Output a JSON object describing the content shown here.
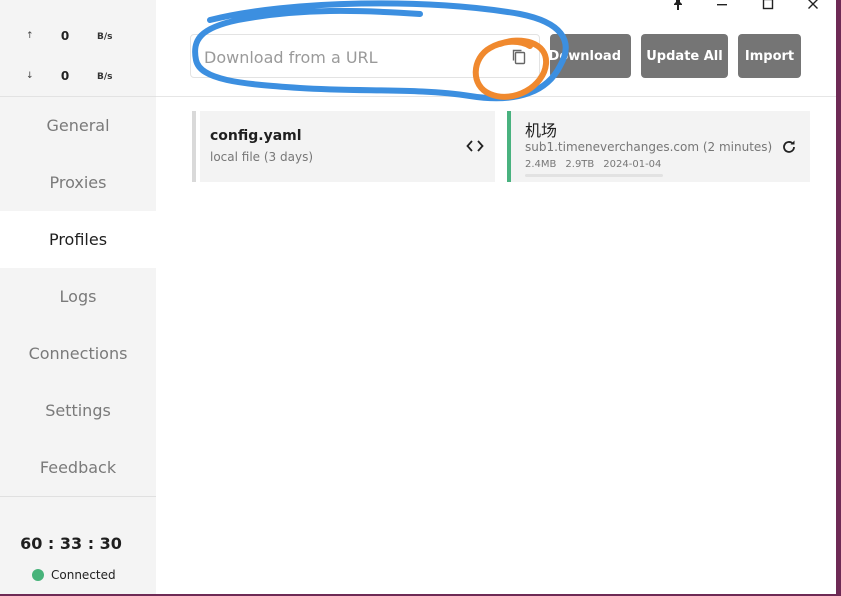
{
  "traffic": {
    "up": {
      "arrow": "↑",
      "value": "0",
      "unit": "B/s"
    },
    "down": {
      "arrow": "↓",
      "value": "0",
      "unit": "B/s"
    }
  },
  "nav": {
    "items": [
      {
        "label": "General"
      },
      {
        "label": "Proxies"
      },
      {
        "label": "Profiles"
      },
      {
        "label": "Logs"
      },
      {
        "label": "Connections"
      },
      {
        "label": "Settings"
      },
      {
        "label": "Feedback"
      }
    ],
    "active_index": 2
  },
  "clock": "60 : 33 : 30",
  "status": {
    "label": "Connected",
    "color": "#47b37a"
  },
  "url_input": {
    "placeholder": "Download from a URL",
    "value": ""
  },
  "buttons": {
    "download": "Download",
    "update_all": "Update All",
    "import": "Import"
  },
  "profiles": [
    {
      "name": "config.yaml",
      "subtitle": "local file (3 days)",
      "icon": "code-icon"
    },
    {
      "name": "机场",
      "subtitle": "sub1.timeneverchanges.com (2 minutes)",
      "meta": [
        "2.4MB",
        "2.9TB",
        "2024-01-04"
      ],
      "usage_fraction": 0.0,
      "icon": "refresh-icon",
      "accent": "#49b27f"
    }
  ],
  "annotations": {
    "blue_color": "#3c8fe0",
    "orange_color": "#f0892e"
  }
}
